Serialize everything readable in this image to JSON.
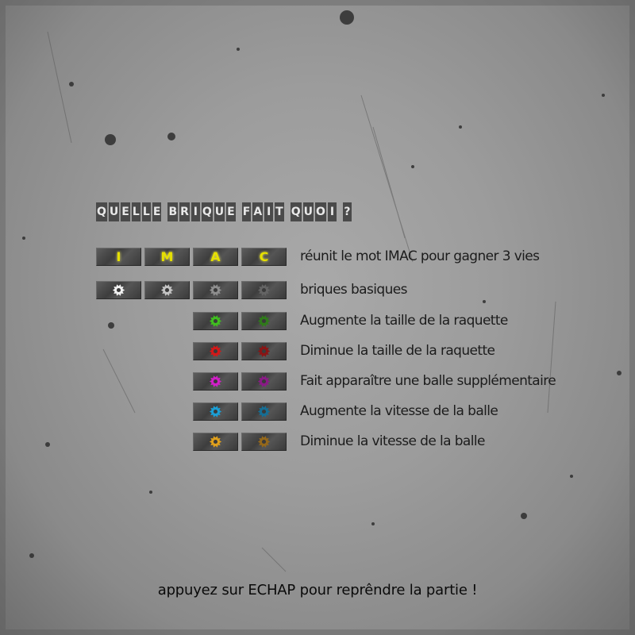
{
  "title_letters": [
    "Q",
    "U",
    "E",
    "L",
    "L",
    "E",
    " ",
    "B",
    "R",
    "I",
    "Q",
    "U",
    "E",
    " ",
    "F",
    "A",
    "I",
    "T",
    " ",
    "Q",
    "U",
    "O",
    "I",
    " ",
    "?"
  ],
  "imac_letters": [
    "I",
    "M",
    "A",
    "C"
  ],
  "rows": [
    {
      "text": "réunit le mot IMAC pour gagner 3 vies"
    },
    {
      "text": "briques basiques"
    },
    {
      "text": "Augmente la taille de la raquette",
      "color": "#3fbf1f",
      "color_dark": "#2f7a1a"
    },
    {
      "text": "Diminue la taille de la raquette",
      "color": "#d41818",
      "color_dark": "#8a1414"
    },
    {
      "text": "Fait apparaître une balle supplémentaire",
      "color": "#d21ec8",
      "color_dark": "#8a1a86"
    },
    {
      "text": "Augmente la vitesse de la balle",
      "color": "#1a9fd6",
      "color_dark": "#156e94"
    },
    {
      "text": "Diminue la vitesse de la balle",
      "color": "#e0a01c",
      "color_dark": "#95681a"
    }
  ],
  "basic_colors": [
    "#f2f2f2",
    "#c4c4c4",
    "#8e8e8e",
    "#646464"
  ],
  "footer": "appuyez sur ECHAP pour reprêndre la partie !"
}
